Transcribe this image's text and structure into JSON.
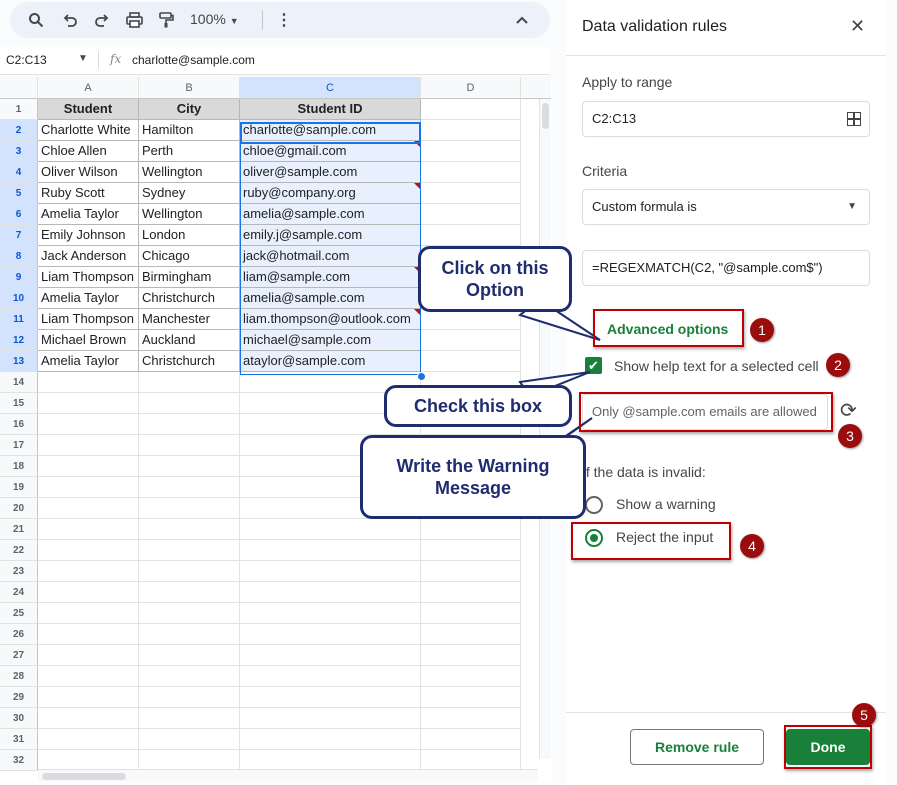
{
  "toolbar": {
    "zoom": "100%"
  },
  "formula_bar": {
    "range": "C2:C13",
    "fx": "fx",
    "value": "charlotte@sample.com"
  },
  "grid": {
    "columns": [
      "A",
      "B",
      "C",
      "D"
    ],
    "rows": [
      "1",
      "2",
      "3",
      "4",
      "5",
      "6",
      "7",
      "8",
      "9",
      "10",
      "11",
      "12",
      "13",
      "14",
      "15",
      "16",
      "17",
      "18",
      "19",
      "20",
      "21",
      "22",
      "23",
      "24",
      "25",
      "26",
      "27",
      "28",
      "29",
      "30",
      "31",
      "32"
    ],
    "headers": [
      "Student",
      "City",
      "Student ID"
    ],
    "data": [
      [
        "Charlotte White",
        "Hamilton",
        "charlotte@sample.com"
      ],
      [
        "Chloe Allen",
        "Perth",
        "chloe@gmail.com"
      ],
      [
        "Oliver Wilson",
        "Wellington",
        "oliver@sample.com"
      ],
      [
        "Ruby Scott",
        "Sydney",
        "ruby@company.org"
      ],
      [
        "Amelia Taylor",
        "Wellington",
        "amelia@sample.com"
      ],
      [
        "Emily Johnson",
        "London",
        "emily.j@sample.com"
      ],
      [
        "Jack Anderson",
        "Chicago",
        "jack@hotmail.com"
      ],
      [
        "Liam Thompson",
        "Birmingham",
        "liam@sample.com"
      ],
      [
        "Amelia Taylor",
        "Christchurch",
        "amelia@sample.com"
      ],
      [
        "Liam Thompson",
        "Manchester",
        "liam.thompson@outlook.com"
      ],
      [
        "Michael Brown",
        "Auckland",
        "michael@sample.com"
      ],
      [
        "Amelia Taylor",
        "Christchurch",
        "ataylor@sample.com"
      ]
    ]
  },
  "panel": {
    "title": "Data validation rules",
    "apply_label": "Apply to range",
    "range": "C2:C13",
    "criteria_label": "Criteria",
    "criteria": "Custom formula is",
    "formula": "=REGEXMATCH(C2, \"@sample.com$\")",
    "advanced": "Advanced options",
    "show_help": "Show help text for a selected cell",
    "help_text": "Only @sample.com emails are allowed",
    "invalid_label": "If the data is invalid:",
    "show_warning": "Show a warning",
    "reject": "Reject the input",
    "remove_rule": "Remove rule",
    "done": "Done"
  },
  "annotations": {
    "callout_option": "Click on this Option",
    "callout_check": "Check this box",
    "callout_warning": "Write the Warning Message",
    "steps": [
      "1",
      "2",
      "3",
      "4",
      "5"
    ]
  },
  "colors": {
    "accent": "#188038",
    "annotation_red": "#c00000",
    "callout_navy": "#1f2d6e",
    "selection_blue": "#1a73e8"
  }
}
